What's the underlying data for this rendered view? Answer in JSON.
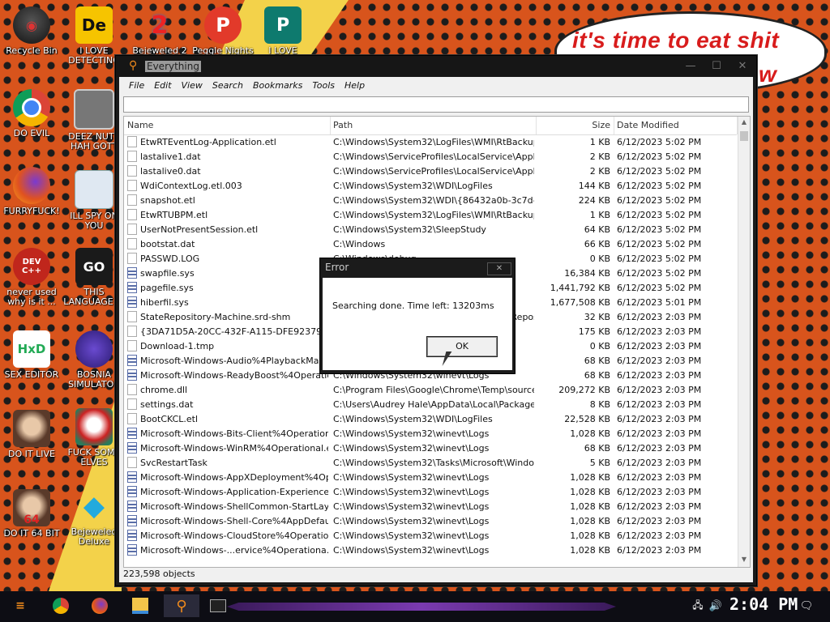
{
  "desktop": {
    "icons": [
      {
        "label": "Recycle Bin",
        "glyph": "recycle-bin-icon"
      },
      {
        "label": "I LOVE\nDETECTING",
        "glyph": "detective-app-icon",
        "text": "De"
      },
      {
        "label": "Bejeweled 2",
        "glyph": "bejeweled-2-icon",
        "text": "2"
      },
      {
        "label": "Peggle Nights",
        "glyph": "peggle-icon",
        "text": "P"
      },
      {
        "label": "I LOVE",
        "glyph": "publisher-icon",
        "text": "P"
      },
      {
        "label": "DO EVIL",
        "glyph": "chrome-icon"
      },
      {
        "label": "DEEZ NUTS\nHAH GOTT",
        "glyph": "windows-stack-icon"
      },
      {
        "label": "FURRYFUCK!",
        "glyph": "firefox-icon"
      },
      {
        "label": "ILL SPY ON\nYOU",
        "glyph": "spy-computer-icon"
      },
      {
        "label": "never used\nwhy is it ...",
        "glyph": "devcpp-icon",
        "text": "DEV C++"
      },
      {
        "label": "THIS\nLANGUAGE ...",
        "glyph": "go-language-icon",
        "text": "GO"
      },
      {
        "label": "SEX EDITOR",
        "glyph": "hxd-editor-icon",
        "text": "HxD"
      },
      {
        "label": "BOSNIA\nSIMULATOR",
        "glyph": "spiky-ball-icon"
      },
      {
        "label": "DO IT LIVE",
        "glyph": "portrait-icon"
      },
      {
        "label": "FUCK SOME\nELVES",
        "glyph": "santa-icon"
      },
      {
        "label": "DO IT 64 BIT",
        "glyph": "portrait-64-icon",
        "text": "64"
      },
      {
        "label": "Bejeweled\nDeluxe",
        "glyph": "diamond-icon"
      }
    ],
    "bubble_text_line1": "it's time to eat shit",
    "bubble_text_line2": "w"
  },
  "window": {
    "title": "Everything",
    "controls": {
      "minimize": "—",
      "maximize": "☐",
      "close": "✕"
    },
    "menu": [
      "File",
      "Edit",
      "View",
      "Search",
      "Bookmarks",
      "Tools",
      "Help"
    ],
    "search_value": "",
    "columns": {
      "name": "Name",
      "path": "Path",
      "size": "Size",
      "modified": "Date Modified"
    },
    "rows": [
      {
        "name": "EtwRTEventLog-Application.etl",
        "path": "C:\\Windows\\System32\\LogFiles\\WMI\\RtBackup",
        "size": "1 KB",
        "modified": "6/12/2023 5:02 PM",
        "icon": "file"
      },
      {
        "name": "lastalive1.dat",
        "path": "C:\\Windows\\ServiceProfiles\\LocalService\\AppDat...",
        "size": "2 KB",
        "modified": "6/12/2023 5:02 PM",
        "icon": "file"
      },
      {
        "name": "lastalive0.dat",
        "path": "C:\\Windows\\ServiceProfiles\\LocalService\\AppDat...",
        "size": "2 KB",
        "modified": "6/12/2023 5:02 PM",
        "icon": "file"
      },
      {
        "name": "WdiContextLog.etl.003",
        "path": "C:\\Windows\\System32\\WDI\\LogFiles",
        "size": "144 KB",
        "modified": "6/12/2023 5:02 PM",
        "icon": "file"
      },
      {
        "name": "snapshot.etl",
        "path": "C:\\Windows\\System32\\WDI\\{86432a0b-3c7d-4d...",
        "size": "224 KB",
        "modified": "6/12/2023 5:02 PM",
        "icon": "file"
      },
      {
        "name": "EtwRTUBPM.etl",
        "path": "C:\\Windows\\System32\\LogFiles\\WMI\\RtBackup",
        "size": "1 KB",
        "modified": "6/12/2023 5:02 PM",
        "icon": "file"
      },
      {
        "name": "UserNotPresentSession.etl",
        "path": "C:\\Windows\\System32\\SleepStudy",
        "size": "64 KB",
        "modified": "6/12/2023 5:02 PM",
        "icon": "file"
      },
      {
        "name": "bootstat.dat",
        "path": "C:\\Windows",
        "size": "66 KB",
        "modified": "6/12/2023 5:02 PM",
        "icon": "file"
      },
      {
        "name": "PASSWD.LOG",
        "path": "C:\\Windows\\debug",
        "size": "0 KB",
        "modified": "6/12/2023 5:02 PM",
        "icon": "file"
      },
      {
        "name": "swapfile.sys",
        "path": "C:\\",
        "size": "16,384 KB",
        "modified": "6/12/2023 5:02 PM",
        "icon": "log"
      },
      {
        "name": "pagefile.sys",
        "path": "C:\\",
        "size": "1,441,792 KB",
        "modified": "6/12/2023 5:02 PM",
        "icon": "log"
      },
      {
        "name": "hiberfil.sys",
        "path": "C:\\",
        "size": "1,677,508 KB",
        "modified": "6/12/2023 5:01 PM",
        "icon": "log"
      },
      {
        "name": "StateRepository-Machine.srd-shm",
        "path": "C:\\ProgramData\\Microsoft\\Windows\\AppRepository",
        "size": "32 KB",
        "modified": "6/12/2023 2:03 PM",
        "icon": "file"
      },
      {
        "name": "{3DA71D5A-20CC-432F-A115-DFE92379E91F}...",
        "path": "C:\\ProgramData\\Microsoft\\Windows\\...",
        "size": "175 KB",
        "modified": "6/12/2023 2:03 PM",
        "icon": "file"
      },
      {
        "name": "Download-1.tmp",
        "path": "C:\\Windows\\SoftwareDistribution",
        "size": "0 KB",
        "modified": "6/12/2023 2:03 PM",
        "icon": "file"
      },
      {
        "name": "Microsoft-Windows-Audio%4PlaybackManager....",
        "path": "C:\\Windows\\System32\\winevt\\Logs",
        "size": "68 KB",
        "modified": "6/12/2023 2:03 PM",
        "icon": "log"
      },
      {
        "name": "Microsoft-Windows-ReadyBoost%4Operational....",
        "path": "C:\\Windows\\System32\\winevt\\Logs",
        "size": "68 KB",
        "modified": "6/12/2023 2:03 PM",
        "icon": "log"
      },
      {
        "name": "chrome.dll",
        "path": "C:\\Program Files\\Google\\Chrome\\Temp\\source7...",
        "size": "209,272 KB",
        "modified": "6/12/2023 2:03 PM",
        "icon": "file"
      },
      {
        "name": "settings.dat",
        "path": "C:\\Users\\Audrey Hale\\AppData\\Local\\Packages...",
        "size": "8 KB",
        "modified": "6/12/2023 2:03 PM",
        "icon": "file"
      },
      {
        "name": "BootCKCL.etl",
        "path": "C:\\Windows\\System32\\WDI\\LogFiles",
        "size": "22,528 KB",
        "modified": "6/12/2023 2:03 PM",
        "icon": "file"
      },
      {
        "name": "Microsoft-Windows-Bits-Client%4Operational.evtx",
        "path": "C:\\Windows\\System32\\winevt\\Logs",
        "size": "1,028 KB",
        "modified": "6/12/2023 2:03 PM",
        "icon": "log"
      },
      {
        "name": "Microsoft-Windows-WinRM%4Operational.evtx",
        "path": "C:\\Windows\\System32\\winevt\\Logs",
        "size": "68 KB",
        "modified": "6/12/2023 2:03 PM",
        "icon": "log"
      },
      {
        "name": "SvcRestartTask",
        "path": "C:\\Windows\\System32\\Tasks\\Microsoft\\Windows...",
        "size": "5 KB",
        "modified": "6/12/2023 2:03 PM",
        "icon": "file"
      },
      {
        "name": "Microsoft-Windows-AppXDeployment%4Operat...",
        "path": "C:\\Windows\\System32\\winevt\\Logs",
        "size": "1,028 KB",
        "modified": "6/12/2023 2:03 PM",
        "icon": "log"
      },
      {
        "name": "Microsoft-Windows-Application-Experience%4...",
        "path": "C:\\Windows\\System32\\winevt\\Logs",
        "size": "1,028 KB",
        "modified": "6/12/2023 2:03 PM",
        "icon": "log"
      },
      {
        "name": "Microsoft-Windows-ShellCommon-StartLayoutP...",
        "path": "C:\\Windows\\System32\\winevt\\Logs",
        "size": "1,028 KB",
        "modified": "6/12/2023 2:03 PM",
        "icon": "log"
      },
      {
        "name": "Microsoft-Windows-Shell-Core%4AppDefaults....",
        "path": "C:\\Windows\\System32\\winevt\\Logs",
        "size": "1,028 KB",
        "modified": "6/12/2023 2:03 PM",
        "icon": "log"
      },
      {
        "name": "Microsoft-Windows-CloudStore%4Operational....",
        "path": "C:\\Windows\\System32\\winevt\\Logs",
        "size": "1,028 KB",
        "modified": "6/12/2023 2:03 PM",
        "icon": "log"
      },
      {
        "name": "Microsoft-Windows-...ervice%4Operationa...",
        "path": "C:\\Windows\\System32\\winevt\\Logs",
        "size": "1,028 KB",
        "modified": "6/12/2023 2:03 PM",
        "icon": "log"
      }
    ],
    "status": "223,598 objects"
  },
  "dialog": {
    "title": "Error",
    "close": "✕",
    "message": "Searching done. Time left: 13203ms",
    "ok_label": "OK"
  },
  "taskbar": {
    "clock": "2:04 PM",
    "apps": [
      "start-icon",
      "chrome-icon",
      "firefox-icon",
      "file-explorer-icon",
      "everything-search-icon",
      "terminal-icon"
    ]
  },
  "colors": {
    "wallpaper_orange": "#d8541c",
    "wallpaper_yellow": "#f3d24a",
    "bubble_text": "#d81c1c",
    "window_frame": "#1a1a1a",
    "taskbar": "#0d0d14"
  }
}
